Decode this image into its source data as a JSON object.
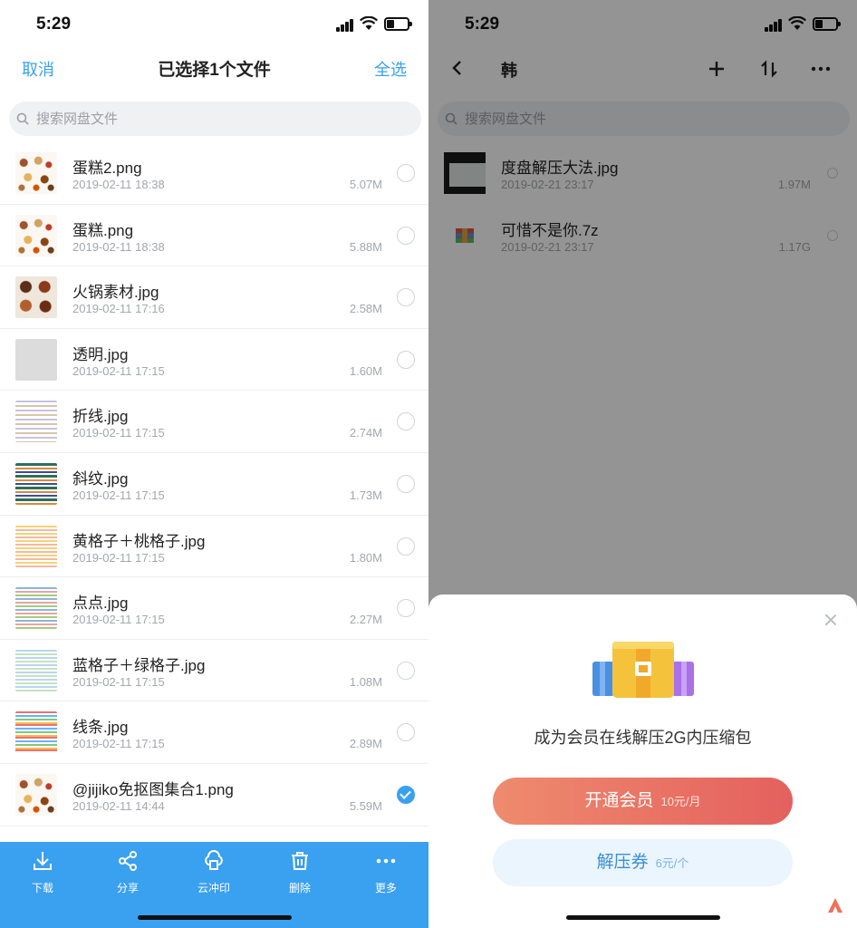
{
  "left": {
    "status": {
      "time": "5:29"
    },
    "header": {
      "cancel": "取消",
      "title": "已选择1个文件",
      "select_all": "全选"
    },
    "search": {
      "placeholder": "搜索网盘文件"
    },
    "files": [
      {
        "name": "蛋糕2.png",
        "date": "2019-02-11 18:38",
        "size": "5.07M",
        "selected": false,
        "thumb": "food"
      },
      {
        "name": "蛋糕.png",
        "date": "2019-02-11 18:38",
        "size": "5.88M",
        "selected": false,
        "thumb": "food"
      },
      {
        "name": "火锅素材.jpg",
        "date": "2019-02-11 17:16",
        "size": "2.58M",
        "selected": false,
        "thumb": "hotpot"
      },
      {
        "name": "透明.jpg",
        "date": "2019-02-11 17:15",
        "size": "1.60M",
        "selected": false,
        "thumb": "clear"
      },
      {
        "name": "折线.jpg",
        "date": "2019-02-11 17:15",
        "size": "2.74M",
        "selected": false,
        "thumb": "zigzag"
      },
      {
        "name": "斜纹.jpg",
        "date": "2019-02-11 17:15",
        "size": "1.73M",
        "selected": false,
        "thumb": "diagonal"
      },
      {
        "name": "黄格子＋桃格子.jpg",
        "date": "2019-02-11 17:15",
        "size": "1.80M",
        "selected": false,
        "thumb": "yellow"
      },
      {
        "name": "点点.jpg",
        "date": "2019-02-11 17:15",
        "size": "2.27M",
        "selected": false,
        "thumb": "dots"
      },
      {
        "name": "蓝格子＋绿格子.jpg",
        "date": "2019-02-11 17:15",
        "size": "1.08M",
        "selected": false,
        "thumb": "blue"
      },
      {
        "name": "线条.jpg",
        "date": "2019-02-11 17:15",
        "size": "2.89M",
        "selected": false,
        "thumb": "lines"
      },
      {
        "name": "@jijiko免抠图集合1.png",
        "date": "2019-02-11 14:44",
        "size": "5.59M",
        "selected": true,
        "thumb": "food"
      }
    ],
    "toolbar": [
      {
        "label": "下载",
        "icon": "download-icon"
      },
      {
        "label": "分享",
        "icon": "share-icon"
      },
      {
        "label": "云冲印",
        "icon": "cloud-print-icon"
      },
      {
        "label": "删除",
        "icon": "trash-icon"
      },
      {
        "label": "更多",
        "icon": "more-icon"
      }
    ],
    "accent": "#3aa0f0"
  },
  "right": {
    "status": {
      "time": "5:29"
    },
    "header": {
      "title": "韩"
    },
    "search": {
      "placeholder": "搜索网盘文件"
    },
    "files": [
      {
        "name": "度盘解压大法.jpg",
        "date": "2019-02-21 23:17",
        "size": "1.97M",
        "thumb": "screenshot"
      },
      {
        "name": "可惜不是你.7z",
        "date": "2019-02-21 23:17",
        "size": "1.17G",
        "thumb": "archive"
      }
    ],
    "sheet": {
      "message": "成为会员在线解压2G内压缩包",
      "vip_button": {
        "label": "开通会员",
        "price": "10元/月"
      },
      "voucher_button": {
        "label": "解压券",
        "price": "6元/个"
      }
    }
  }
}
